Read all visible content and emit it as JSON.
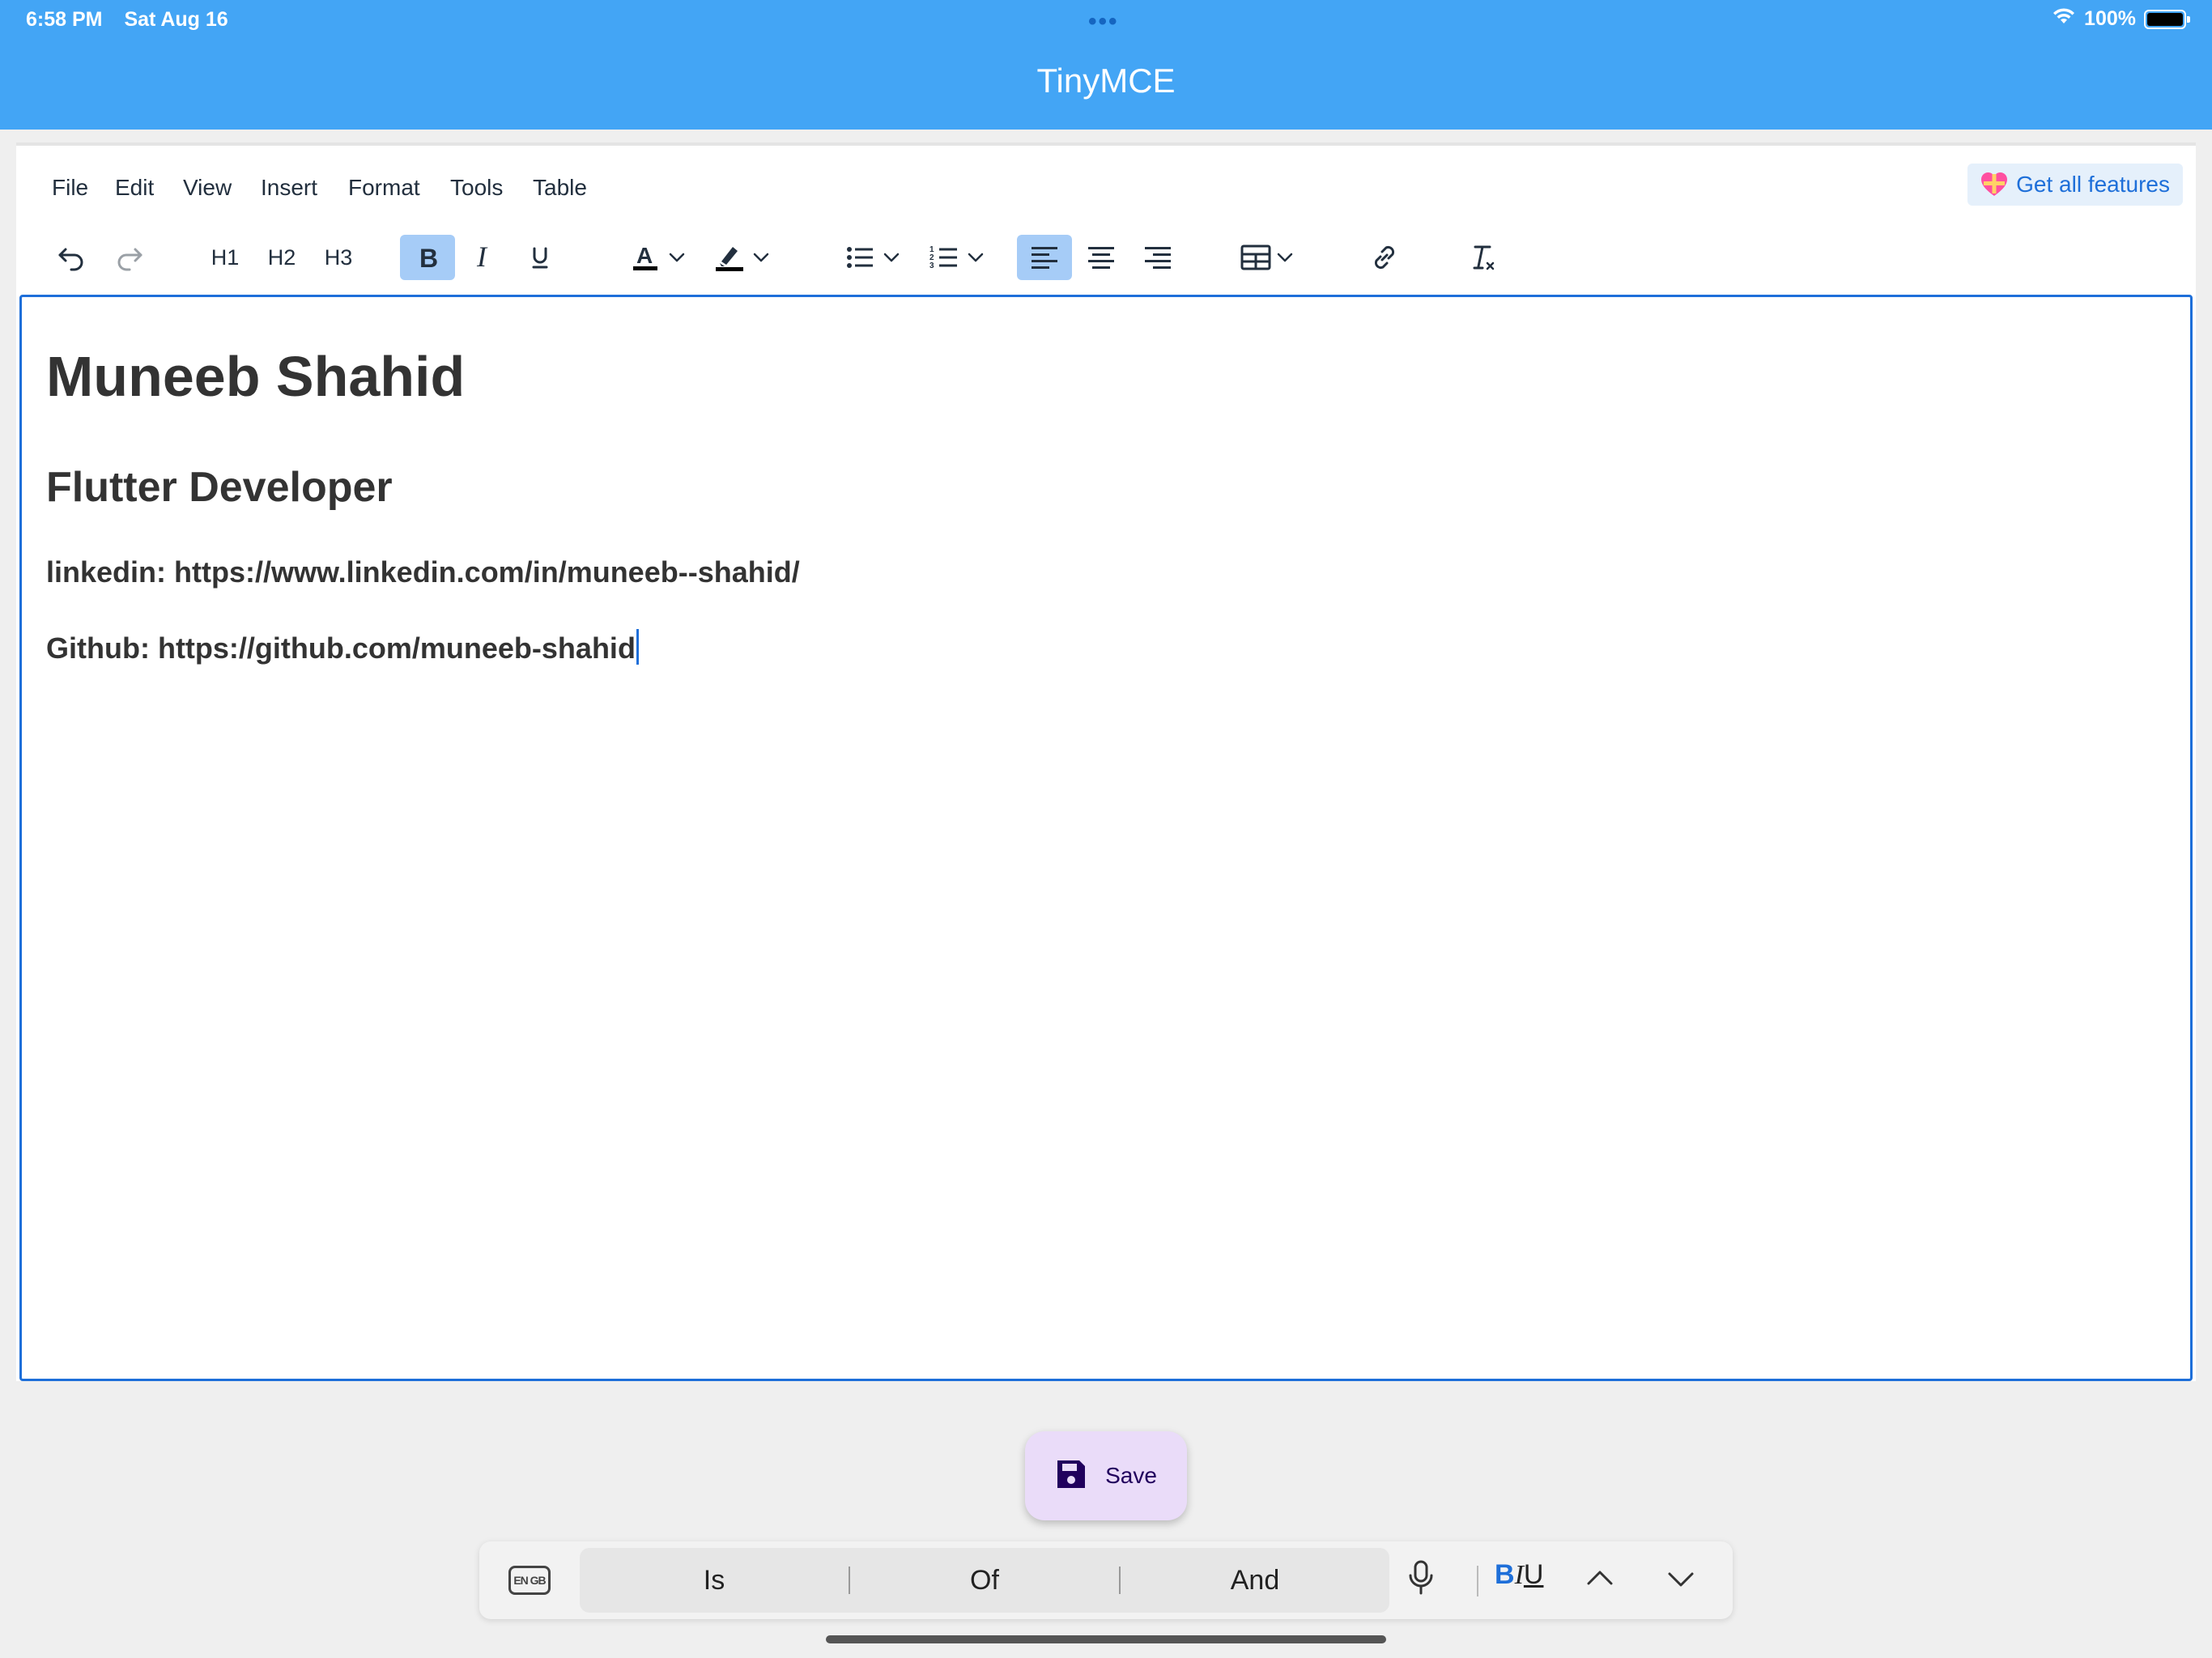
{
  "status_bar": {
    "time": "6:58 PM",
    "date": "Sat Aug 16",
    "dots": "•••",
    "battery": "100%"
  },
  "app_bar": {
    "title": "TinyMCE",
    "color": "#43a5f5"
  },
  "menubar": {
    "items": [
      "File",
      "Edit",
      "View",
      "Insert",
      "Format",
      "Tools",
      "Table"
    ],
    "promo_label": "Get all features"
  },
  "toolbar": {
    "icons": [
      "undo-icon",
      "redo-icon",
      "bold-icon",
      "italic-icon",
      "underline-icon",
      "text-color-icon",
      "highlight-icon",
      "bullet-list-icon",
      "numbered-list-icon",
      "align-left-icon",
      "align-center-icon",
      "align-right-icon",
      "table-icon",
      "link-icon",
      "clear-formatting-icon"
    ],
    "h1": "H1",
    "h2": "H2",
    "h3": "H3",
    "bold_active": true,
    "align_left_active": true
  },
  "document": {
    "heading1": "Muneeb Shahid",
    "heading2": "Flutter Developer",
    "linkedin": "linkedin: https://www.linkedin.com/in/muneeb--shahid/",
    "github": "Github: https://github.com/muneeb-shahid"
  },
  "save_button": {
    "label": "Save",
    "icon": "save-icon"
  },
  "keyboard_bar": {
    "language": "EN GB",
    "suggestions": [
      "Is",
      "Of",
      "And"
    ],
    "format_bold": "B",
    "format_italic": "I",
    "format_underline": "U"
  }
}
